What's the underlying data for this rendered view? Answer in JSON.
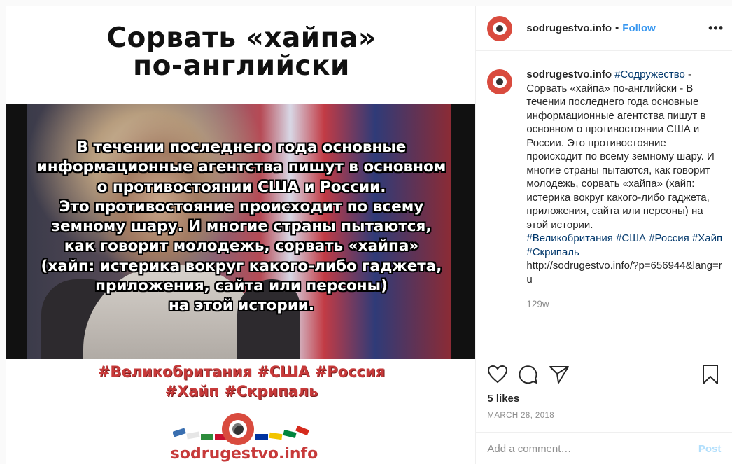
{
  "post": {
    "image": {
      "title_lines": [
        "Сорвать «хайпа»",
        "по-английски"
      ],
      "overlay_lines": [
        "В течении последнего года основные",
        "информационные агентства пишут в основном",
        "о противостоянии США и России.",
        "Это противостояние происходит по всему",
        "земному шару. И многие страны пытаются,",
        "как говорит молодежь, сорвать «хайпа»",
        "(хайп: истерика вокруг какого-либо гаджета,",
        "приложения, сайта или персоны)",
        "на этой истории."
      ],
      "hashtag_lines": [
        "#Великобритания #США #Россия",
        "#Хайп #Скрипаль"
      ],
      "logo_text": "sodrugestvo.info"
    },
    "header": {
      "username": "sodrugestvo.info",
      "separator": "•",
      "follow_label": "Follow",
      "more_label": "•••"
    },
    "caption": {
      "username": "sodrugestvo.info",
      "hashtag_top": "#Содружество",
      "text": " - Сорвать «хайпа» по-английски - В течении последнего года основные информационные агентства пишут в основном о противостоянии США и России. Это противостояние происходит по всему земному шару. И многие страны пытаются, как говорит молодежь, сорвать «хайпа» (хайп: истерика вокруг какого-либо гаджета, приложения, сайта или персоны) на этой истории.",
      "tags": [
        "#Великобритания",
        "#США",
        "#Россия",
        "#Хайп",
        "#Скрипаль"
      ],
      "link": "http://sodrugestvo.info/?p=656944&lang=ru",
      "time_ago": "129w"
    },
    "likes": "5 likes",
    "date": "MARCH 28, 2018",
    "comment": {
      "placeholder": "Add a comment…",
      "post_label": "Post"
    },
    "colors": {
      "follow": "#3897f0",
      "hashtag_link": "#00376b",
      "brand_red": "#d94b3e",
      "post_disabled": "#b2dffc"
    },
    "icons": [
      "heart-icon",
      "comment-icon",
      "share-icon",
      "bookmark-icon",
      "more-icon"
    ]
  }
}
